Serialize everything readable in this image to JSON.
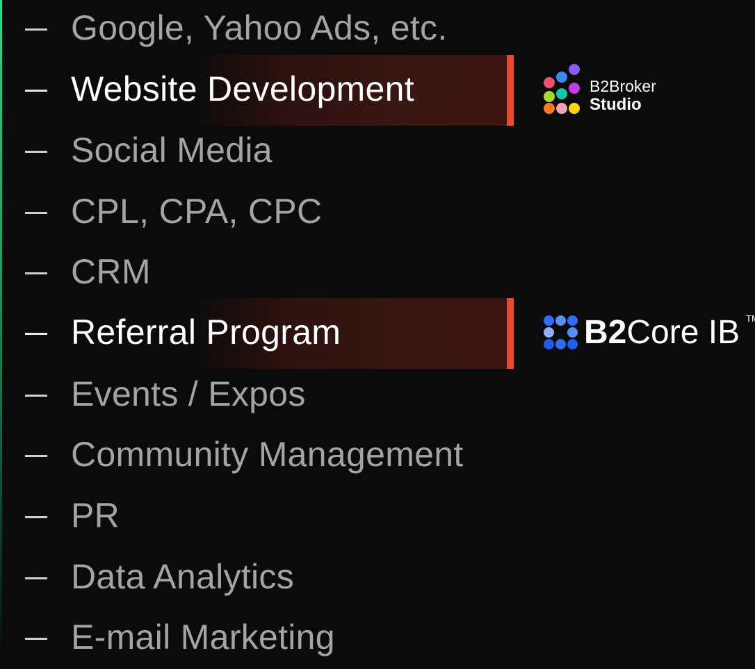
{
  "items": [
    {
      "label": "Google, Yahoo Ads, etc."
    },
    {
      "label": "Website Development"
    },
    {
      "label": "Social Media"
    },
    {
      "label": "CPL, CPA, CPC"
    },
    {
      "label": "CRM"
    },
    {
      "label": "Referral Program"
    },
    {
      "label": "Events / Expos"
    },
    {
      "label": "Community Management"
    },
    {
      "label": "PR"
    },
    {
      "label": "Data Analytics"
    },
    {
      "label": "E-mail Marketing"
    }
  ],
  "highlighted": [
    "Website Development",
    "Referral Program"
  ],
  "logos": {
    "studio": {
      "line1": "B2Broker",
      "line2": "Studio"
    },
    "core": {
      "part1": "B2",
      "part2": "Core IB",
      "tm": "TM"
    }
  },
  "colors": {
    "background": "#0b0b0b",
    "highlight_edge": "#ea4b30",
    "accent_line": "#2fd58f",
    "text_dim": "#a4a4a4",
    "text_bright": "#ffffff"
  }
}
